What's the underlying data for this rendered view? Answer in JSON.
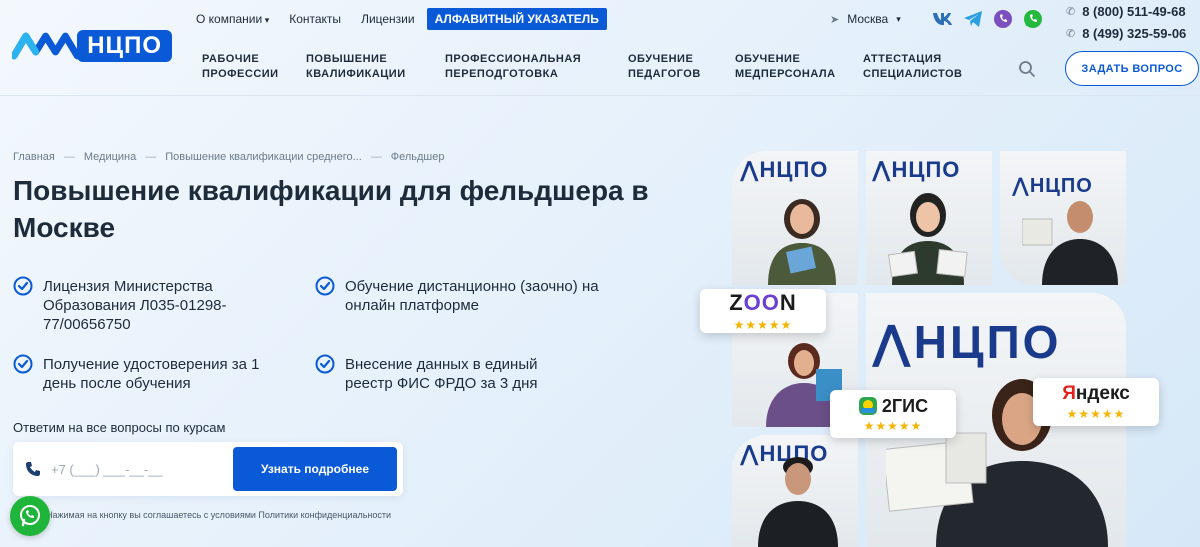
{
  "header": {
    "logo_text": "НЦПО",
    "topnav": [
      {
        "label": "О компании",
        "dropdown": true
      },
      {
        "label": "Контакты",
        "dropdown": false
      },
      {
        "label": "Лицензии",
        "dropdown": false
      }
    ],
    "alpha_index": "АЛФАВИТНЫЙ УКАЗАТЕЛЬ",
    "city": "Москва",
    "socials": [
      "vk-icon",
      "telegram-icon",
      "viber-icon",
      "whatsapp-icon"
    ],
    "phones": [
      "8 (800) 511-49-68",
      "8 (499) 325-59-06"
    ],
    "mainnav": [
      "Рабочие\nпрофессии",
      "Повышение\nквалификации",
      "Профессиональная\nпереподготовка",
      "Обучение\nпедагогов",
      "Обучение\nмедперсонала",
      "Аттестация\nспециалистов"
    ],
    "ask_button": "Задать вопрос"
  },
  "breadcrumb": [
    "Главная",
    "Медицина",
    "Повышение квалификации среднего...",
    "Фельдшер"
  ],
  "page_title": "Повышение квалификации для фельдшера в Москве",
  "features": [
    "Лицензия Министерства Образования Л035-01298-77/00656750",
    "Обучение дистанционно (заочно) на онлайн платформе",
    "Получение удостоверения за 1 день после обучения",
    "Внесение данных в единый реестр ФИС ФРДО за 3 дня"
  ],
  "form": {
    "label": "Ответим на все вопросы по курсам",
    "phone_placeholder": "+7 (___) ___-__-__",
    "submit": "Узнать подробнее",
    "agree_text": "Нажимая на кнопку вы соглашаетесь с условиями Политики конфиденциальности"
  },
  "reviews": [
    {
      "name": "ZOON",
      "stars": "★★★★★"
    },
    {
      "name": "2ГИС",
      "stars": "★★★★★"
    },
    {
      "name": "Яндекс",
      "stars": "★★★★★"
    }
  ],
  "colors": {
    "brand": "#0a5ad8",
    "text": "#1d2b3a",
    "star": "#f5b400",
    "whatsapp": "#1fb53a"
  }
}
